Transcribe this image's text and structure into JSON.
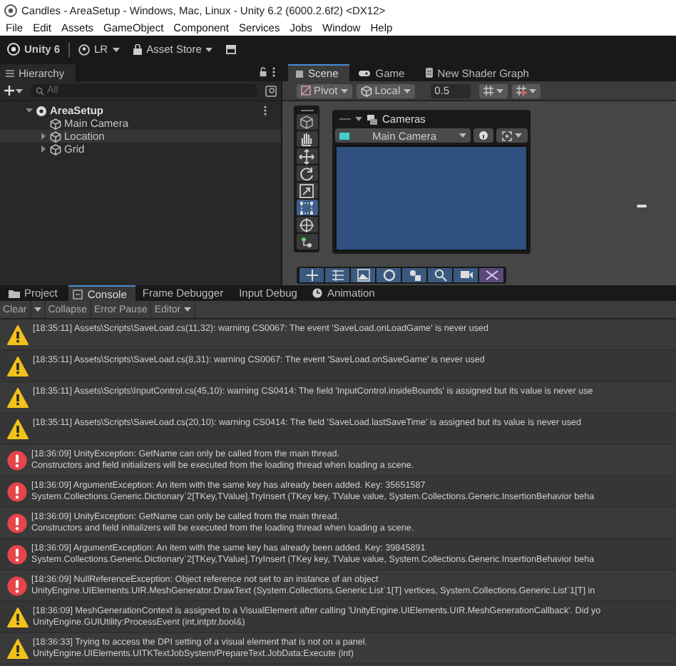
{
  "window": {
    "title": "Candles - AreaSetup - Windows, Mac, Linux - Unity 6.2 (6000.2.6f2) <DX12>"
  },
  "menu": [
    "File",
    "Edit",
    "Assets",
    "GameObject",
    "Component",
    "Services",
    "Jobs",
    "Window",
    "Help"
  ],
  "toolbar": {
    "product": "Unity 6",
    "account": "LR",
    "store": "Asset Store"
  },
  "hierarchy": {
    "title": "Hierarchy",
    "search": {
      "placeholder": "All"
    },
    "tree": [
      {
        "label": "AreaSetup",
        "kind": "scene",
        "expanded": true,
        "hovered": false,
        "children": [
          {
            "label": "Main Camera",
            "kind": "object",
            "hovered": false
          },
          {
            "label": "Location",
            "kind": "object",
            "expanded": false,
            "hovered": true
          },
          {
            "label": "Grid",
            "kind": "object",
            "expanded": false,
            "hovered": false
          }
        ]
      }
    ]
  },
  "scene": {
    "tabs": [
      {
        "label": "Scene",
        "kind": "scene",
        "selected": true
      },
      {
        "label": "Game",
        "kind": "game",
        "selected": false
      },
      {
        "label": "New Shader Graph",
        "kind": "graph",
        "selected": false
      }
    ],
    "pivot": "Pivot",
    "space": "Local",
    "snap": {
      "value": "0.5"
    },
    "tools": [
      {
        "kind": "view",
        "selected": false
      },
      {
        "kind": "hand",
        "selected": false
      },
      {
        "kind": "move",
        "selected": false
      },
      {
        "kind": "rotate",
        "selected": false
      },
      {
        "kind": "scale",
        "selected": false
      },
      {
        "kind": "rect",
        "selected": true
      },
      {
        "kind": "transform",
        "selected": false
      },
      {
        "kind": "custom",
        "selected": false
      }
    ],
    "cameras": {
      "title": "Cameras",
      "camera": "Main Camera"
    }
  },
  "console": {
    "tabs": [
      {
        "label": "Project",
        "kind": "project",
        "selected": false
      },
      {
        "label": "Console",
        "kind": "console",
        "selected": true
      },
      {
        "label": "Frame Debugger",
        "kind": "plain",
        "selected": false
      },
      {
        "label": "Input Debug",
        "kind": "plain",
        "selected": false
      },
      {
        "label": "Animation",
        "kind": "animation",
        "selected": false
      }
    ],
    "toolbar": {
      "clear": "Clear",
      "collapse": "Collapse",
      "error_pause": "Error Pause",
      "target": "Editor"
    },
    "entries": [
      {
        "kind": "warning",
        "lines": [
          "[18:35:11] Assets\\Scripts\\SaveLoad.cs(11,32): warning CS0067: The event 'SaveLoad.onLoadGame' is never used"
        ]
      },
      {
        "kind": "warning",
        "lines": [
          "[18:35:11] Assets\\Scripts\\SaveLoad.cs(8,31): warning CS0067: The event 'SaveLoad.onSaveGame' is never used"
        ]
      },
      {
        "kind": "warning",
        "lines": [
          "[18:35:11] Assets\\Scripts\\InputControl.cs(45,10): warning CS0414: The field 'InputControl.insideBounds' is assigned but its value is never use"
        ]
      },
      {
        "kind": "warning",
        "lines": [
          "[18:35:11] Assets\\Scripts\\SaveLoad.cs(20,10): warning CS0414: The field 'SaveLoad.lastSaveTime' is assigned but its value is never used"
        ]
      },
      {
        "kind": "error",
        "lines": [
          "[18:36:09] UnityException: GetName can only be called from the main thread.",
          "Constructors and field initializers will be executed from the loading thread when loading a scene."
        ]
      },
      {
        "kind": "error",
        "lines": [
          "[18:36:09] ArgumentException: An item with the same key has already been added. Key: 35651587",
          "System.Collections.Generic.Dictionary`2[TKey,TValue].TryInsert (TKey key, TValue value, System.Collections.Generic.InsertionBehavior beha"
        ]
      },
      {
        "kind": "error",
        "lines": [
          "[18:36:09] UnityException: GetName can only be called from the main thread.",
          "Constructors and field initializers will be executed from the loading thread when loading a scene."
        ]
      },
      {
        "kind": "error",
        "lines": [
          "[18:36:09] ArgumentException: An item with the same key has already been added. Key: 39845891",
          "System.Collections.Generic.Dictionary`2[TKey,TValue].TryInsert (TKey key, TValue value, System.Collections.Generic.InsertionBehavior beha"
        ]
      },
      {
        "kind": "error",
        "lines": [
          "[18:36:09] NullReferenceException: Object reference not set to an instance of an object",
          "UnityEngine.UIElements.UIR.MeshGenerator.DrawText (System.Collections.Generic.List`1[T] vertices, System.Collections.Generic.List`1[T] in"
        ]
      },
      {
        "kind": "warning",
        "lines": [
          "[18:36:09] MeshGenerationContext is assigned to a VisualElement after calling 'UnityEngine.UIElements.UIR.MeshGenerationCallback'. Did yo",
          "UnityEngine.GUIUtility:ProcessEvent (int,intptr,bool&)"
        ]
      },
      {
        "kind": "warning",
        "lines": [
          "[18:36:33] Trying to access the DPI setting of a visual element that is not on a panel.",
          "UnityEngine.UIElements.UITKTextJobSystem/PrepareText.JobData:Execute (int)"
        ]
      }
    ]
  }
}
